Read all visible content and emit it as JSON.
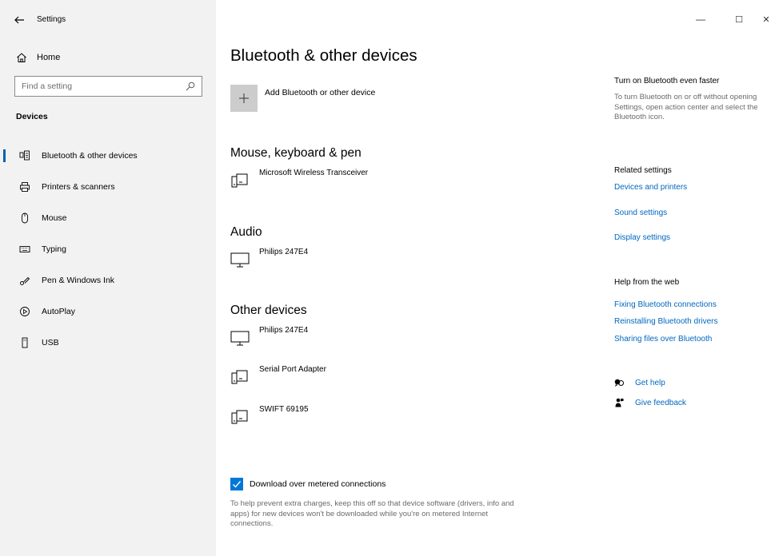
{
  "window": {
    "title": "Settings",
    "controls": {
      "minimize": "—",
      "maximize": "☐",
      "close": "✕"
    }
  },
  "sidebar": {
    "home_label": "Home",
    "search_placeholder": "Find a setting",
    "section_title": "Devices",
    "items": [
      {
        "label": "Bluetooth & other devices",
        "icon": "bluetooth-devices-icon",
        "active": true
      },
      {
        "label": "Printers & scanners",
        "icon": "printer-icon",
        "active": false
      },
      {
        "label": "Mouse",
        "icon": "mouse-icon",
        "active": false
      },
      {
        "label": "Typing",
        "icon": "keyboard-icon",
        "active": false
      },
      {
        "label": "Pen & Windows Ink",
        "icon": "pen-icon",
        "active": false
      },
      {
        "label": "AutoPlay",
        "icon": "autoplay-icon",
        "active": false
      },
      {
        "label": "USB",
        "icon": "usb-icon",
        "active": false
      }
    ]
  },
  "main": {
    "title": "Bluetooth & other devices",
    "add_device_label": "Add Bluetooth or other device",
    "groups": [
      {
        "title": "Mouse, keyboard & pen",
        "devices": [
          {
            "name": "Microsoft Wireless Transceiver",
            "icon": "device-icon"
          }
        ]
      },
      {
        "title": "Audio",
        "devices": [
          {
            "name": "Philips 247E4",
            "icon": "monitor-icon"
          }
        ]
      },
      {
        "title": "Other devices",
        "devices": [
          {
            "name": "Philips 247E4",
            "icon": "monitor-icon"
          },
          {
            "name": "Serial Port Adapter",
            "icon": "device-icon"
          },
          {
            "name": "SWIFT 69195",
            "icon": "device-icon"
          }
        ]
      }
    ],
    "metered": {
      "label": "Download over metered connections",
      "checked": true,
      "help_text": "To help prevent extra charges, keep this off so that device software (drivers, info and apps) for new devices won't be downloaded while you're on metered Internet connections."
    }
  },
  "side_panel": {
    "faster_heading": "Turn on Bluetooth even faster",
    "faster_text": "To turn Bluetooth on or off without opening Settings, open action center and select the Bluetooth icon.",
    "related_heading": "Related settings",
    "related_links": [
      "Devices and printers",
      "Sound settings",
      "Display settings"
    ],
    "help_heading": "Help from the web",
    "help_links": [
      "Fixing Bluetooth connections",
      "Reinstalling Bluetooth drivers",
      "Sharing files over Bluetooth"
    ],
    "get_help": "Get help",
    "give_feedback": "Give feedback"
  },
  "colors": {
    "accent": "#0078d7",
    "link": "#0067c0",
    "sidebar_bg": "#f2f2f2"
  }
}
